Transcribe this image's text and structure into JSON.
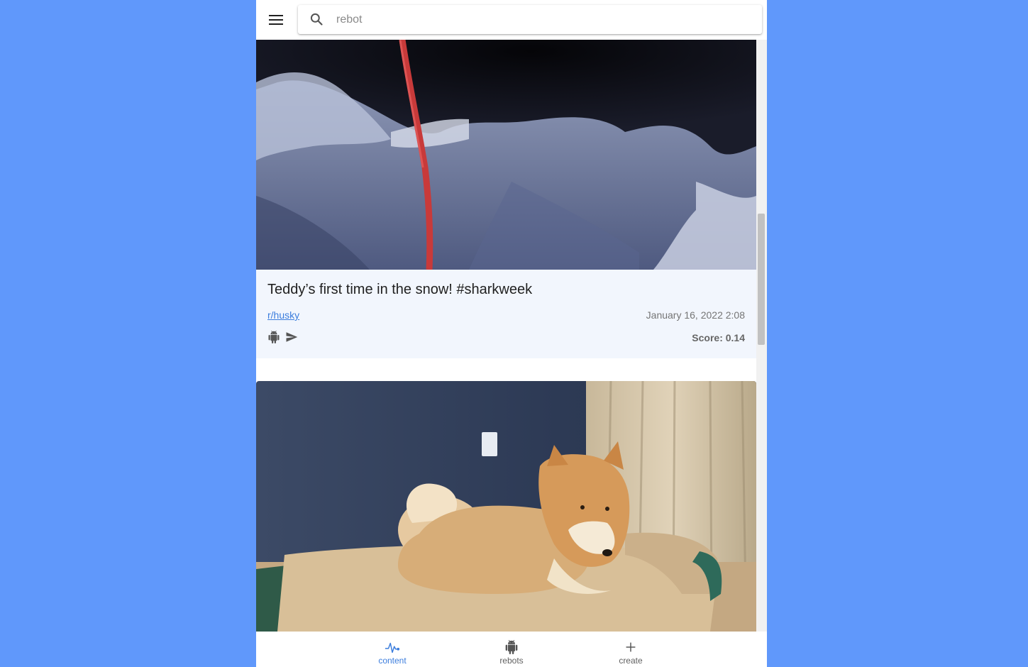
{
  "search": {
    "placeholder": "rebot",
    "value": ""
  },
  "posts": [
    {
      "title": "Teddy’s first time in the snow! #sharkweek",
      "subreddit": "r/husky",
      "date": "January 16, 2022 2:08",
      "score": "Score: 0.14"
    },
    {
      "image": "akita-dog-on-bed"
    }
  ],
  "nav": {
    "items": [
      {
        "label": "content",
        "icon": "pulse-icon",
        "active": true
      },
      {
        "label": "rebots",
        "icon": "android-icon",
        "active": false
      },
      {
        "label": "create",
        "icon": "plus-icon",
        "active": false
      }
    ]
  },
  "colors": {
    "background": "#6098fb",
    "accent": "#3b7ddd",
    "card": "#f2f6fd"
  }
}
